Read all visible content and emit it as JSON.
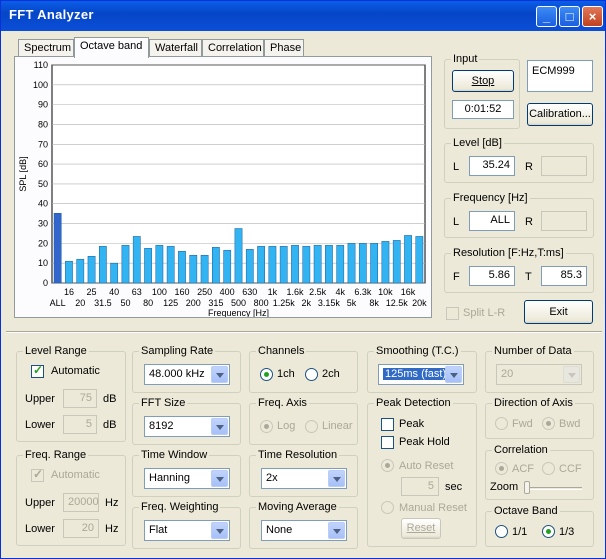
{
  "window": {
    "title": "FFT Analyzer"
  },
  "tabs": [
    "Spectrum",
    "Octave band",
    "Waterfall",
    "Correlation",
    "Phase"
  ],
  "active_tab": "Octave band",
  "chart_data": {
    "type": "bar",
    "ylabel": "SPL [dB]",
    "xlabel": "Frequency [Hz]",
    "ylim": [
      0,
      110
    ],
    "yticks": [
      0,
      10,
      20,
      30,
      40,
      50,
      60,
      70,
      80,
      90,
      100,
      110
    ],
    "grid": true,
    "categories": [
      "ALL",
      "16",
      "20",
      "25",
      "31.5",
      "40",
      "50",
      "63",
      "80",
      "100",
      "125",
      "160",
      "200",
      "250",
      "315",
      "400",
      "500",
      "630",
      "800",
      "1k",
      "1.25k",
      "1.6k",
      "2k",
      "2.5k",
      "3.15k",
      "4k",
      "5k",
      "6.3k",
      "8k",
      "10k",
      "12.5k",
      "16k",
      "20k"
    ],
    "x_labels_top": [
      "16",
      "25",
      "40",
      "63",
      "100",
      "160",
      "250",
      "400",
      "630",
      "1k",
      "1.6k",
      "2.5k",
      "4k",
      "6.3k",
      "10k",
      "16k"
    ],
    "x_labels_bottom": [
      "ALL",
      "20",
      "31.5",
      "50",
      "80",
      "125",
      "200",
      "315",
      "500",
      "800",
      "1.25k",
      "2k",
      "3.15k",
      "5k",
      "8k",
      "12.5k",
      "20k"
    ],
    "values": [
      35.2,
      11,
      12,
      13.5,
      18.5,
      10,
      19,
      23.5,
      17.5,
      19,
      18.5,
      16,
      14,
      14,
      18,
      16.5,
      27.5,
      17,
      18.5,
      18.5,
      18.5,
      19,
      18.5,
      19,
      19,
      19,
      20,
      20,
      20,
      21,
      21.5,
      24,
      23.5
    ],
    "highlight_color": "#3366cc",
    "bar_color": "#33b4f2"
  },
  "input": {
    "title": "Input",
    "stop_label": "Stop",
    "time": "0:01:52",
    "mic": "ECM999",
    "calibration_label": "Calibration..."
  },
  "level": {
    "title": "Level [dB]",
    "l_label": "L",
    "l_value": "35.24",
    "r_label": "R",
    "r_value": ""
  },
  "frequency": {
    "title": "Frequency [Hz]",
    "l_label": "L",
    "l_value": "ALL",
    "r_label": "R",
    "r_value": ""
  },
  "resolution": {
    "title": "Resolution [F:Hz,T:ms]",
    "f_label": "F",
    "f_value": "5.86",
    "t_label": "T",
    "t_value": "85.3"
  },
  "split_lr_label": "Split L-R",
  "exit_label": "Exit",
  "level_range": {
    "title": "Level Range",
    "auto_label": "Automatic",
    "upper_label": "Upper",
    "upper_value": "75",
    "lower_label": "Lower",
    "lower_value": "5",
    "unit": "dB"
  },
  "freq_range": {
    "title": "Freq. Range",
    "auto_label": "Automatic",
    "upper_label": "Upper",
    "upper_value": "20000",
    "lower_label": "Lower",
    "lower_value": "20",
    "unit": "Hz"
  },
  "sampling_rate": {
    "title": "Sampling Rate",
    "value": "48.000 kHz"
  },
  "fft_size": {
    "title": "FFT Size",
    "value": "8192"
  },
  "time_window": {
    "title": "Time Window",
    "value": "Hanning"
  },
  "freq_weighting": {
    "title": "Freq. Weighting",
    "value": "Flat"
  },
  "channels": {
    "title": "Channels",
    "opt1": "1ch",
    "opt2": "2ch",
    "selected": "1ch"
  },
  "freq_axis": {
    "title": "Freq. Axis",
    "opt1": "Log",
    "opt2": "Linear"
  },
  "time_resolution": {
    "title": "Time Resolution",
    "value": "2x"
  },
  "moving_average": {
    "title": "Moving Average",
    "value": "None"
  },
  "smoothing": {
    "title": "Smoothing (T.C.)",
    "value": "125ms (fast)"
  },
  "peak_detection": {
    "title": "Peak Detection",
    "peak_label": "Peak",
    "peak_hold_label": "Peak Hold",
    "auto_reset_label": "Auto Reset",
    "sec_value": "5",
    "sec_unit": "sec",
    "manual_reset_label": "Manual Reset",
    "reset_label": "Reset"
  },
  "number_of_data": {
    "title": "Number of Data",
    "value": "20"
  },
  "direction_axis": {
    "title": "Direction of Axis",
    "opt1": "Fwd",
    "opt2": "Bwd"
  },
  "correlation": {
    "title": "Correlation",
    "opt1": "ACF",
    "opt2": "CCF",
    "zoom_label": "Zoom"
  },
  "octave_band": {
    "title": "Octave Band",
    "opt1": "1/1",
    "opt2": "1/3",
    "selected": "1/3"
  }
}
